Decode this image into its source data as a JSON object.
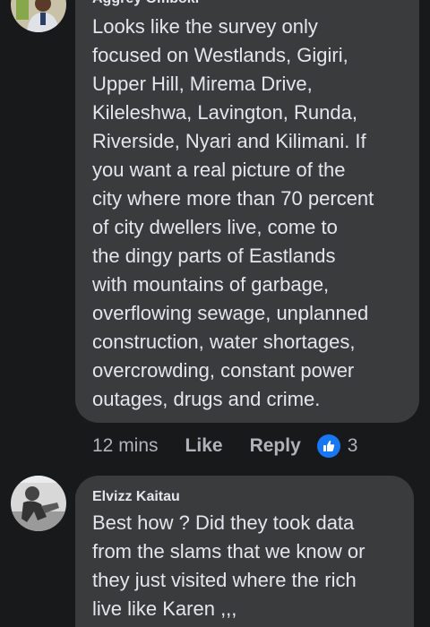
{
  "comments": [
    {
      "author": "Aggrey Omboki",
      "text": "Looks like the survey only\nfocused on Westlands, Gigiri,\nUpper Hill, Mirema Drive,\nKileleshwa, Lavington, Runda,\nRiverside, Nyari and Kilimani. If\nyou want a real picture of the\ncity where more than 70 percent\nof city dwellers live, come to\nthe dingy parts of Eastlands\nwith mountains of garbage,\noverflowing sewage, unplanned\nconstruction, water shortages,\novercrowding, constant power\noutages, drugs and crime.",
      "time": "12 mins",
      "like_label": "Like",
      "reply_label": "Reply",
      "reaction_icon": "like-thumbs-up-icon",
      "reaction_count": "3"
    },
    {
      "author": "Elvizz Kaitau",
      "text": "Best how ? Did they took data\nfrom the slams that we know or\nthey just visited where the rich\nlive like Karen ,,,"
    }
  ],
  "colors": {
    "background": "#18191a",
    "bubble": "#3a3b3c",
    "text": "#e4e6eb",
    "secondary_text": "#b0b3b8",
    "reaction_blue": "#1877f2"
  }
}
